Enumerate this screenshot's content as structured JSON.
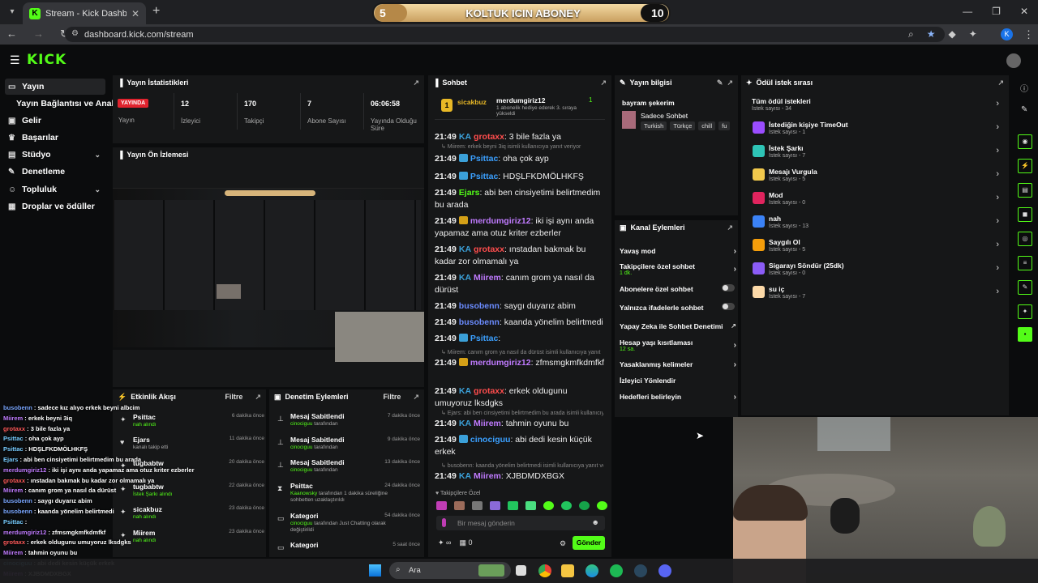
{
  "browser": {
    "tab_title": "Stream - Kick Dashboard",
    "url": "dashboard.kick.com/stream",
    "profile_initial": "K"
  },
  "overlay": {
    "left_num": "5",
    "title": "KOLTUK ICIN ABONEY",
    "right_num": "10"
  },
  "kick": {
    "logo": "KICK"
  },
  "sidebar": {
    "items": [
      {
        "label": "Yayın",
        "icon": "video-icon"
      },
      {
        "label": "Yayın Bağlantısı ve Anahtarı",
        "icon": ""
      },
      {
        "label": "Gelir",
        "icon": "wallet-icon"
      },
      {
        "label": "Başarılar",
        "icon": "trophy-icon"
      },
      {
        "label": "Stüdyo",
        "icon": "studio-icon"
      },
      {
        "label": "Denetleme",
        "icon": "wrench-icon"
      },
      {
        "label": "Topluluk",
        "icon": "people-icon"
      },
      {
        "label": "Droplar ve ödüller",
        "icon": "gift-icon"
      }
    ]
  },
  "stats": {
    "title": "Yayın İstatistikleri",
    "live_badge": "YAYINDA",
    "live_label": "Yayın",
    "items": [
      {
        "value": "12",
        "label": "İzleyici"
      },
      {
        "value": "170",
        "label": "Takipçi"
      },
      {
        "value": "7",
        "label": "Abone Sayısı"
      },
      {
        "value": "06:06:58",
        "label": "Yayında Olduğu Süre"
      }
    ]
  },
  "preview": {
    "title": "Yayın Ön İzlemesi"
  },
  "activity": {
    "title": "Etkinlik Akışı",
    "filter": "Filtre",
    "rows": [
      {
        "name": "Psittac",
        "sub": "nah alındı",
        "time": "6 dakika önce",
        "icon": "star-icon"
      },
      {
        "name": "Ejars",
        "sub": "kanalı takip etti",
        "time": "11 dakika önce",
        "icon": "heart-icon"
      },
      {
        "name": "tugbabtw",
        "sub": "",
        "time": "20 dakika önce",
        "icon": "star-icon"
      },
      {
        "name": "tugbabtw",
        "sub": "İstek Şarkı alındı",
        "time": "22 dakika önce",
        "icon": "star-icon"
      },
      {
        "name": "sicakbuz",
        "sub": "nah alındı",
        "time": "23 dakika önce",
        "icon": "star-icon"
      },
      {
        "name": "Miirem",
        "sub": "nah alındı",
        "time": "23 dakika önce",
        "icon": "star-icon"
      }
    ]
  },
  "moderation": {
    "title": "Denetim Eylemleri",
    "filter": "Filtre",
    "rows": [
      {
        "name": "Mesaj Sabitlendi",
        "actor": "cinociguu",
        "sub": "tarafından",
        "time": "7 dakika önce",
        "icon": "pin-icon"
      },
      {
        "name": "Mesaj Sabitlendi",
        "actor": "cinociguu",
        "sub": "tarafından",
        "time": "9 dakika önce",
        "icon": "pin-icon"
      },
      {
        "name": "Mesaj Sabitlendi",
        "actor": "cinociguu",
        "sub": "tarafından",
        "time": "13 dakika önce",
        "icon": "pin-icon"
      },
      {
        "name": "Psittac",
        "actor": "Kaanowsky",
        "sub": "tarafından 1 dakika süreliğine sohbetten uzaklaştırıldı",
        "time": "24 dakika önce",
        "icon": "timeout-icon"
      },
      {
        "name": "Kategori",
        "actor": "cinociguu",
        "sub": "tarafından Just Chatting olarak değiştirildi",
        "time": "54 dakika önce",
        "icon": "category-icon"
      },
      {
        "name": "Kategori",
        "actor": "",
        "sub": "",
        "time": "5 saat önce",
        "icon": "category-icon"
      }
    ]
  },
  "chat": {
    "title": "Sohbet",
    "pinned_user": "sicakbuz",
    "pinned_gifter": "merdumgiriz12",
    "pinned_count": "1",
    "pinned_text": "1 abonelik hediye ederek 3. sıraya yükseldi",
    "lines": [
      {
        "time": "21:49",
        "user": "grotaxx",
        "color": "#ff4d4d",
        "badge": "KA",
        "msg": ": 3 bile fazla ya"
      },
      {
        "reply": "Miirem: erkek beyni 3iq isimli kullanıcıya yanıt veriyor"
      },
      {
        "time": "21:49",
        "user": "Psittac",
        "color": "#3ba0ff",
        "badge": "sub",
        "msg": ": oha çok ayp"
      },
      {
        "time": "21:49",
        "user": "Psittac",
        "color": "#3ba0ff",
        "badge": "sub",
        "msg": ": HDŞLFKDMÖLHKFŞ"
      },
      {
        "time": "21:49",
        "user": "Ejars",
        "color": "#53fc18",
        "badge": "",
        "msg": ": abi ben cinsiyetimi belirtmedim bu arada"
      },
      {
        "time": "21:49",
        "user": "merdumgiriz12",
        "color": "#c07bff",
        "badge": "crown",
        "msg": ": iki işi aynı anda yapamaz ama otuz kriter ezberler"
      },
      {
        "time": "21:49",
        "user": "grotaxx",
        "color": "#ff4d4d",
        "badge": "KA",
        "msg": ": ınstadan bakmak bu kadar zor olmamalı ya"
      },
      {
        "time": "21:49",
        "user": "Miirem",
        "color": "#c07bff",
        "badge": "KA",
        "msg": ": canım grom ya nasıl da dürüst"
      },
      {
        "time": "21:49",
        "user": "busobenn",
        "color": "#6b8cff",
        "badge": "",
        "msg": ": saygı duyarız abim"
      },
      {
        "time": "21:49",
        "user": "busobenn",
        "color": "#6b8cff",
        "badge": "",
        "msg": ": kaanda yönelim belirtmedi"
      },
      {
        "time": "21:49",
        "user": "Psittac",
        "color": "#3ba0ff",
        "badge": "sub",
        "msg": ": "
      },
      {
        "reply": "Miirem: canım grom ya nasıl da dürüst isimli kullanıcıya yanıt"
      },
      {
        "time": "21:49",
        "user": "merdumgiriz12",
        "color": "#c07bff",
        "badge": "crown",
        "msg": ": zfmsmgkmfkdmfkf"
      },
      {
        "time": "21:49",
        "user": "grotaxx",
        "color": "#ff4d4d",
        "badge": "KA",
        "msg": ": erkek oldugunu umuyoruz lksdgks"
      },
      {
        "reply": "Ejars: abi ben cinsiyetimi belirtmedim bu arada isimli kullanıcıya yanıt"
      },
      {
        "time": "21:49",
        "user": "Miirem",
        "color": "#c07bff",
        "badge": "KA",
        "msg": ": tahmin oyunu bu"
      },
      {
        "time": "21:49",
        "user": "cinociguu",
        "color": "#3ba0ff",
        "badge": "sub",
        "msg": ": abi dedi kesin küçük erkek"
      },
      {
        "reply": "busobenn: kaanda yönelim belirtmedi isimli kullanıcıya yanıt ve"
      },
      {
        "time": "21:49",
        "user": "Miirem",
        "color": "#c07bff",
        "badge": "KA",
        "msg": ": XJBDMDXBGX"
      }
    ],
    "followers_only": "Takipçilere Özel",
    "input_placeholder": "Bir mesaj gönderin",
    "points": "0",
    "send": "Gönder"
  },
  "stream_info": {
    "title": "Yayın bilgisi",
    "stream_title": "bayram şekerim",
    "category": "Sadece Sohbet",
    "tags": [
      "Turkish",
      "Türkçe",
      "chill",
      "fu"
    ]
  },
  "channel_actions": {
    "title": "Kanal Eylemleri",
    "rows": [
      {
        "label": "Yavaş mod",
        "sub": "",
        "control": "chevron"
      },
      {
        "label": "Takipçilere özel sohbet",
        "sub": "1 dk.",
        "control": "chevron"
      },
      {
        "label": "Abonelere özel sohbet",
        "sub": "",
        "control": "toggle"
      },
      {
        "label": "Yalnızca ifadelerle sohbet",
        "sub": "",
        "control": "toggle"
      },
      {
        "label": "Yapay Zeka ile Sohbet Denetimi",
        "sub": "",
        "control": "external"
      },
      {
        "label": "Hesap yaşı kısıtlaması",
        "sub": "12 sa.",
        "control": "chevron"
      },
      {
        "label": "Yasaklanmış kelimeler",
        "sub": "",
        "control": "chevron"
      },
      {
        "label": "İzleyici Yönlendir",
        "sub": "",
        "control": ""
      },
      {
        "label": "Hedefleri belirleyin",
        "sub": "",
        "control": "chevron"
      }
    ]
  },
  "rewards": {
    "title": "Ödül istek sırası",
    "all_label": "Tüm ödül istekleri",
    "all_count": "İstek sayısı - 34",
    "rows": [
      {
        "name": "İstediğin kişiye TimeOut",
        "count": "İstek sayısı - 1",
        "color": "#9b4dff"
      },
      {
        "name": "İstek Şarkı",
        "count": "İstek sayısı - 7",
        "color": "#2ec4b6"
      },
      {
        "name": "Mesajı Vurgula",
        "count": "İstek sayısı - 5",
        "color": "#f2c94c"
      },
      {
        "name": "Mod",
        "count": "İstek sayısı - 0",
        "color": "#e0245e"
      },
      {
        "name": "nah",
        "count": "İstek sayısı - 13",
        "color": "#3b82f6"
      },
      {
        "name": "Saygılı Ol",
        "count": "İstek sayısı - 5",
        "color": "#f59e0b"
      },
      {
        "name": "Sigarayı Söndür (25dk)",
        "count": "İstek sayısı - 0",
        "color": "#8b5cf6"
      },
      {
        "name": "su iç",
        "count": "İstek sayısı - 7",
        "color": "#fcd9a8"
      }
    ]
  },
  "obs_overlay": [
    {
      "user": "busobenn",
      "msg": " : sadece kız alıyo erkek beyni albcim",
      "c": "u"
    },
    {
      "user": "Miirem",
      "msg": " : erkek beyni 3iq",
      "c": "u2"
    },
    {
      "user": "grotaxx",
      "msg": " : 3 bile fazla ya",
      "c": "u3"
    },
    {
      "user": "Psittac",
      "msg": " : oha çok ayp",
      "c": "u4"
    },
    {
      "user": "Psittac",
      "msg": " : HDŞLFKDMÖLHKFŞ",
      "c": "u4"
    },
    {
      "user": "Ejars",
      "msg": " : abi ben cinsiyetimi belirtmedim bu arada",
      "c": "u4"
    },
    {
      "user": "merdumgiriz12",
      "msg": " : iki işi aynı anda yapamaz ama otuz kriter ezberler",
      "c": "u2"
    },
    {
      "user": "grotaxx",
      "msg": " : ınstadan bakmak bu kadar zor olmamalı ya",
      "c": "u3"
    },
    {
      "user": "Miirem",
      "msg": " : canım grom ya nasıl da dürüst",
      "c": "u2"
    },
    {
      "user": "busobenn",
      "msg": " : saygı duyarız abim",
      "c": "u"
    },
    {
      "user": "busobenn",
      "msg": " : kaanda yönelim belirtmedi",
      "c": "u"
    },
    {
      "user": "Psittac",
      "msg": " :",
      "c": "u4"
    },
    {
      "user": "merdumgiriz12",
      "msg": " : zfmsmgkmfkdmfkf",
      "c": "u2"
    },
    {
      "user": "grotaxx",
      "msg": " : erkek oldugunu umuyoruz lksdgks",
      "c": "u3"
    },
    {
      "user": "Miirem",
      "msg": " : tahmin oyunu bu",
      "c": "u2"
    },
    {
      "user": "cinociguu",
      "msg": " : abi dedi kesin küçük erkek",
      "c": "u4"
    },
    {
      "user": "Miirem",
      "msg": " : XJBDMDXBGX",
      "c": "u2"
    }
  ],
  "taskbar": {
    "search": "Ara"
  }
}
